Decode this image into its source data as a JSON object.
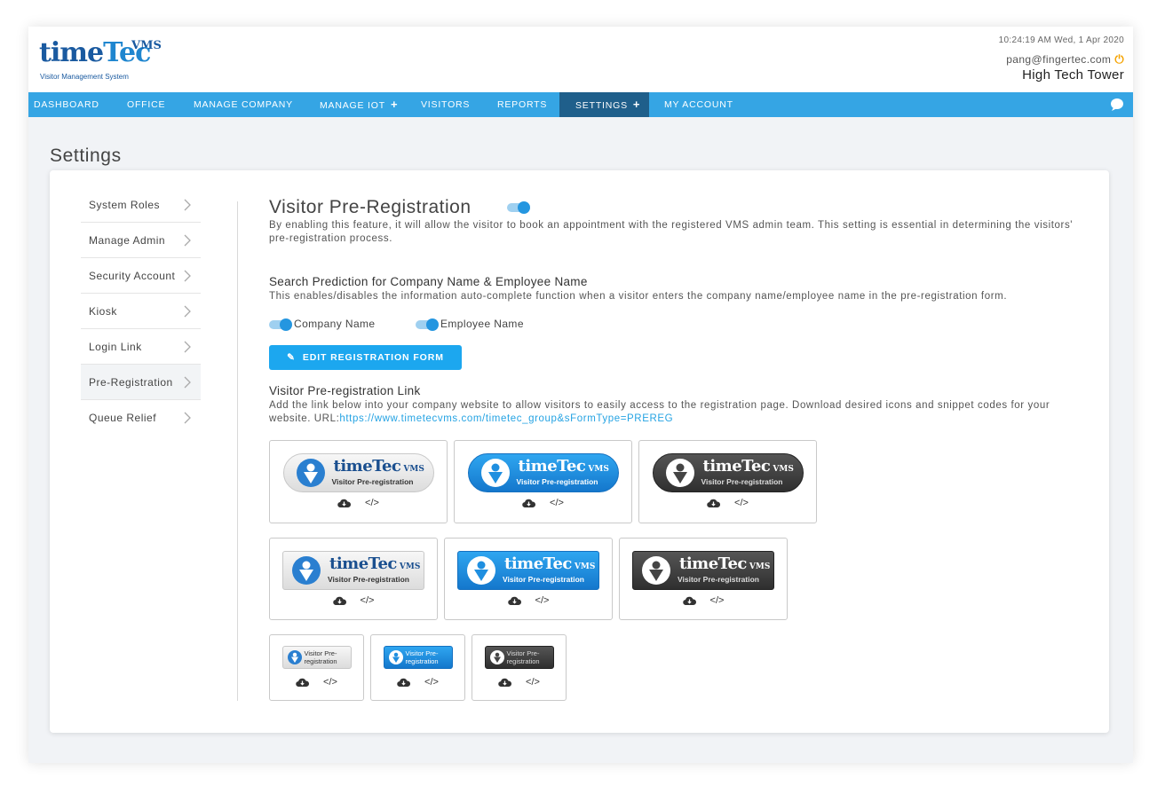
{
  "header": {
    "logo_word_a": "time",
    "logo_word_b": "Tec",
    "logo_vms": "VMS",
    "logo_sub": "Visitor Management System",
    "datetime": "10:24:19 AM  Wed, 1 Apr 2020",
    "email": "pang@fingertec.com",
    "building": "High Tech Tower"
  },
  "nav": {
    "dashboard": "DASHBOARD",
    "office": "OFFICE",
    "manage_company": "MANAGE COMPANY",
    "manage_iot": "MANAGE IOT",
    "visitors": "VISITORS",
    "reports": "REPORTS",
    "settings": "SETTINGS",
    "my_account": "MY ACCOUNT",
    "plus": "+"
  },
  "page_title": "Settings",
  "sidebar": {
    "items": [
      "System Roles",
      "Manage Admin",
      "Security Account",
      "Kiosk",
      "Login Link",
      "Pre-Registration",
      "Queue Relief"
    ]
  },
  "content": {
    "title": "Visitor Pre-Registration",
    "title_toggle_on": true,
    "description": "By enabling this feature, it will allow the visitor to book an appointment with the registered VMS admin team. This setting is essential in determining the visitors' pre-registration process.",
    "search_heading": "Search Prediction for Company Name & Employee Name",
    "search_desc": "This enables/disables the information auto-complete function when a visitor enters the company name/employee name in the pre-registration form.",
    "company_name_label": "Company Name",
    "employee_name_label": "Employee Name",
    "edit_button": "EDIT REGISTRATION FORM",
    "link_heading": "Visitor Pre-registration Link",
    "link_desc": "Add the link below into your company website to allow visitors to easily access to the registration page. Download desired icons and snippet codes for your website. URL:",
    "link_url": "https://www.timetecvms.com/timetec_group&sFormType=PREREG"
  },
  "badges": {
    "brand_a": "time",
    "brand_b": "Tec",
    "brand_vms": "VMS",
    "subtitle": "Visitor Pre-registration",
    "small_line1": "Visitor Pre-",
    "small_line2": "registration",
    "code_icon": "</>",
    "download_icon": "cloud-download-icon",
    "colors": {
      "light": "#e9e9e9",
      "blue": "#1f8fe0",
      "dark": "#3d3d3d"
    }
  }
}
